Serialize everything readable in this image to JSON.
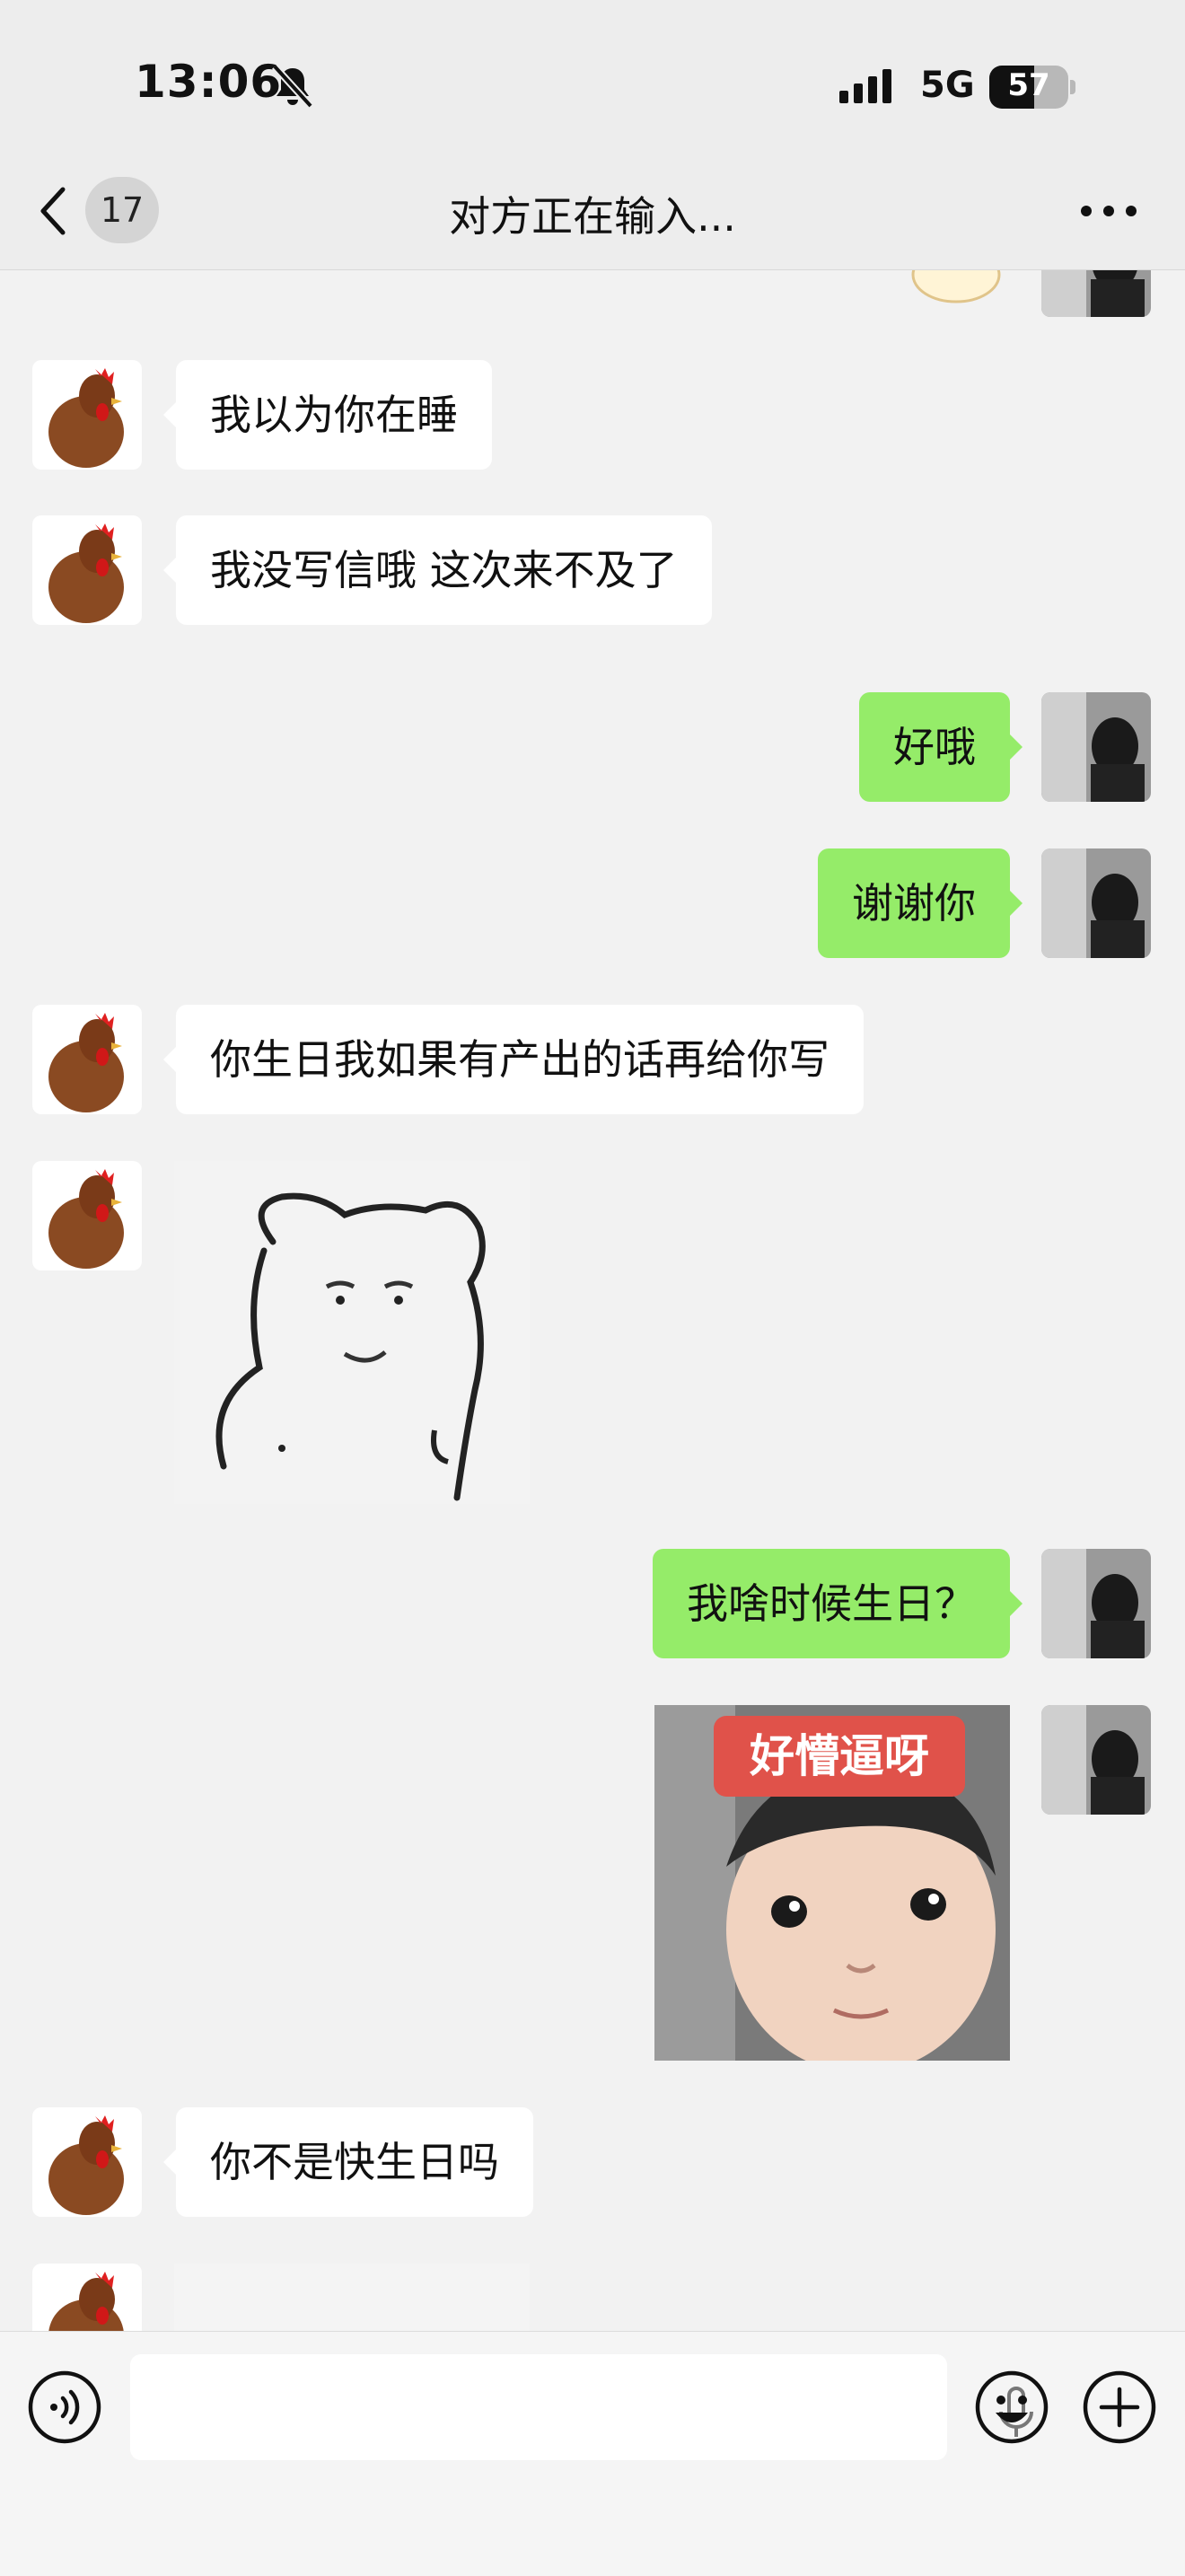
{
  "status_bar": {
    "time": "13:06",
    "network": "5G",
    "battery": "57",
    "battery_level": 0.57
  },
  "nav": {
    "unread_count": "17",
    "title": "对方正在输入..."
  },
  "messages": [
    {
      "side": "in",
      "type": "text",
      "text": "我以为你在睡"
    },
    {
      "side": "in",
      "type": "text",
      "text": "我没写信哦 这次来不及了"
    },
    {
      "side": "out",
      "type": "text",
      "text": "好哦"
    },
    {
      "side": "out",
      "type": "text",
      "text": "谢谢你"
    },
    {
      "side": "in",
      "type": "text",
      "text": "你生日我如果有产出的话再给你写"
    },
    {
      "side": "in",
      "type": "sticker",
      "sticker": "bear-sketch-sticker"
    },
    {
      "side": "out",
      "type": "text",
      "text": "我啥时候生日？"
    },
    {
      "side": "out",
      "type": "sticker",
      "sticker": "baby-face-sticker",
      "caption": "好懵逼呀"
    },
    {
      "side": "in",
      "type": "text",
      "text": "你不是快生日吗"
    }
  ],
  "icons": {
    "voice": "voice-icon",
    "emoji": "emoji-icon",
    "plus": "plus-icon",
    "mic": "mic-icon"
  },
  "colors": {
    "outgoing_bubble": "#95ec69",
    "incoming_bubble": "#ffffff",
    "background": "#f2f2f2"
  }
}
